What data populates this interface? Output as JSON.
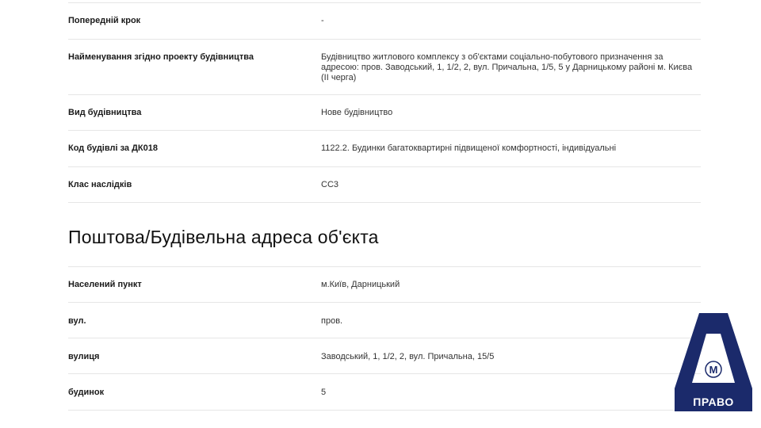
{
  "general": {
    "rows": [
      {
        "label": "Попередній крок",
        "value": "-"
      },
      {
        "label": "Найменування згідно проекту будівництва",
        "value": "Будівництво житлового комплексу з об'єктами соціально-побутового призначення за адресою: пров. Заводський, 1, 1/2, 2, вул. Причальна, 1/5, 5 у Дарницькому районі м. Києва (II черга)"
      },
      {
        "label": "Вид будівництва",
        "value": "Нове будівництво"
      },
      {
        "label": "Код будівлі за ДК018",
        "value": "1122.2. Будинки багатоквартирні підвищеної комфортності, індивідуальні"
      },
      {
        "label": "Клас наслідків",
        "value": "СС3"
      }
    ]
  },
  "address": {
    "title": "Поштова/Будівельна адреса об'єкта",
    "rows": [
      {
        "label": "Населений пункт",
        "value": "м.Київ, Дарницький"
      },
      {
        "label": "вул.",
        "value": "пров."
      },
      {
        "label": "вулиця",
        "value": "Заводський, 1, 1/2, 2, вул. Причальна, 15/5"
      },
      {
        "label": "будинок",
        "value": "5"
      }
    ]
  },
  "logo": {
    "text": "ПРАВО",
    "letter": "M",
    "colors": {
      "primary": "#1b2a6b",
      "background": "#ffffff"
    }
  }
}
